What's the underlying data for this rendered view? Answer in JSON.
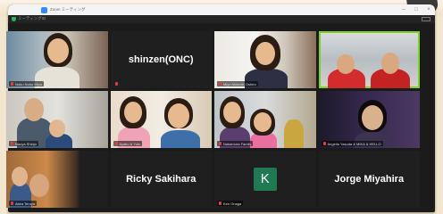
{
  "app": {
    "title": "Zoom ミーティング",
    "meeting_info": "ミーティングID",
    "window_controls": {
      "minimize": "–",
      "maximize": "□",
      "close": "×"
    }
  },
  "participants": [
    {
      "name": "Nobu Noho Miya",
      "display": "video",
      "active": false
    },
    {
      "name": "shinzen(ONC)",
      "display": "name",
      "active": false
    },
    {
      "name": "Miyu Akimoto Oshiro",
      "display": "video",
      "active": false
    },
    {
      "name": "",
      "display": "video",
      "active": true
    },
    {
      "name": "Naoya Shinjo",
      "display": "video",
      "active": false
    },
    {
      "name": "Ayako & Yuto",
      "display": "video",
      "active": false
    },
    {
      "name": "Nakamura Family",
      "display": "video",
      "active": false
    },
    {
      "name": "Angelia Yasuda & MIKA & HELLO",
      "display": "video",
      "active": false
    },
    {
      "name": "Akira Teruya",
      "display": "video",
      "active": false
    },
    {
      "name": "Ricky Sakihara",
      "display": "name",
      "active": false
    },
    {
      "name": "Ken Onaga",
      "display": "avatar",
      "avatar_letter": "K",
      "active": false
    },
    {
      "name": "Jorge Miyahira",
      "display": "name",
      "active": false
    }
  ],
  "colors": {
    "active_speaker": "#7ed321",
    "avatar_bg": "#1f7a52",
    "mic_muted": "#e03e3e"
  }
}
